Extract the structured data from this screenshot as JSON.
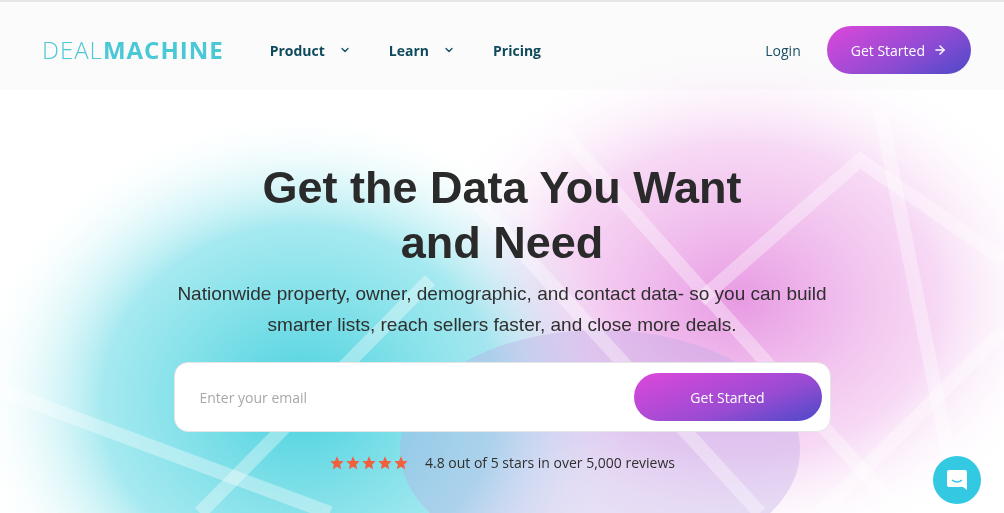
{
  "header": {
    "logo": {
      "light": "DEAL",
      "bold": "MACHINE"
    },
    "nav": [
      {
        "label": "Product",
        "kind": "dropdown"
      },
      {
        "label": "Learn",
        "kind": "dropdown"
      },
      {
        "label": "Pricing",
        "kind": "link"
      }
    ],
    "login": "Login",
    "cta": "Get Started"
  },
  "hero": {
    "title": "Get the Data You Want and Need",
    "subtitle": "Nationwide property, owner, demographic, and contact data- so you can build smarter lists, reach sellers faster, and close more deals.",
    "email": {
      "placeholder": "Enter your email"
    },
    "button": "Get Started",
    "rating": {
      "stars": 5,
      "text": "4.8 out of 5 stars in over 5,000 reviews"
    }
  }
}
